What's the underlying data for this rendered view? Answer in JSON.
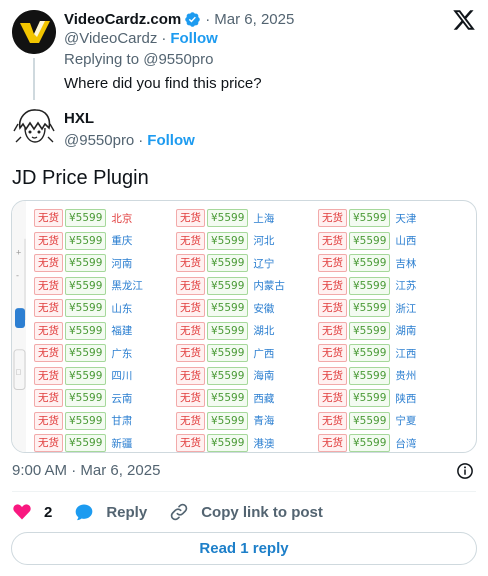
{
  "parent_tweet": {
    "name": "VideoCardz.com",
    "date": "Mar 6, 2025",
    "handle": "@VideoCardz",
    "separator": "·",
    "follow_label": "Follow",
    "replying_to": "Replying to @9550pro",
    "text": "Where did you find this price?"
  },
  "main_tweet": {
    "name": "HXL",
    "handle": "@9550pro",
    "separator": "·",
    "follow_label": "Follow",
    "text": "JD Price Plugin",
    "timestamp": "9:00 AM · Mar 6, 2025"
  },
  "media": {
    "stock_label": "无货",
    "price_label": "¥5599",
    "regions": [
      "北京",
      "上海",
      "天津",
      "重庆",
      "河北",
      "山西",
      "河南",
      "辽宁",
      "吉林",
      "黑龙江",
      "内蒙古",
      "江苏",
      "山东",
      "安徽",
      "浙江",
      "福建",
      "湖北",
      "湖南",
      "广东",
      "广西",
      "江西",
      "四川",
      "海南",
      "贵州",
      "云南",
      "西藏",
      "陕西",
      "甘肃",
      "青海",
      "宁夏",
      "新疆",
      "港澳",
      "台湾"
    ],
    "colors": {
      "stock": "#e03a3a",
      "price": "#4a9a36",
      "region": "#2a7ed0"
    }
  },
  "actions": {
    "likes": "2",
    "reply_label": "Reply",
    "copy_label": "Copy link to post",
    "read_replies_label": "Read 1 reply"
  },
  "icons": {
    "verified": "verified-badge-icon",
    "x_logo": "x-logo-icon",
    "info": "info-icon",
    "heart": "heart-icon",
    "reply": "reply-bubble-icon",
    "link": "link-icon"
  },
  "colors": {
    "accent": "#1d9bf0",
    "like": "#f91880",
    "muted": "#536471"
  }
}
